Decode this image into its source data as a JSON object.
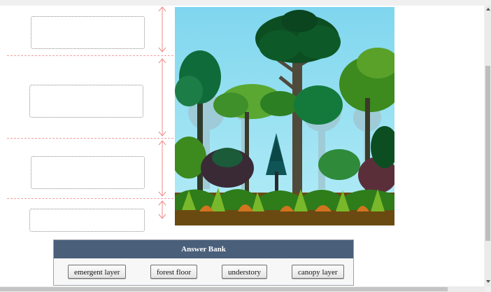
{
  "answer_bank": {
    "title": "Answer Bank",
    "items": [
      "emergent layer",
      "forest floor",
      "understory",
      "canopy layer"
    ]
  },
  "drop_zones": [
    "",
    "",
    "",
    ""
  ],
  "image": {
    "subject": "rainforest-layers-illustration"
  }
}
